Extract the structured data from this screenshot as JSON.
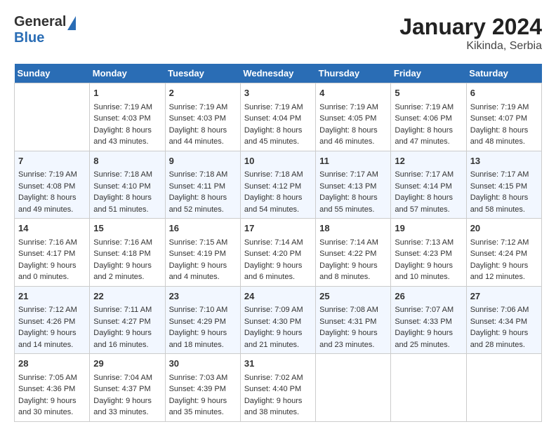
{
  "header": {
    "logo_general": "General",
    "logo_blue": "Blue",
    "month_year": "January 2024",
    "location": "Kikinda, Serbia"
  },
  "days_of_week": [
    "Sunday",
    "Monday",
    "Tuesday",
    "Wednesday",
    "Thursday",
    "Friday",
    "Saturday"
  ],
  "weeks": [
    [
      {
        "day": "",
        "sunrise": "",
        "sunset": "",
        "daylight": ""
      },
      {
        "day": "1",
        "sunrise": "Sunrise: 7:19 AM",
        "sunset": "Sunset: 4:03 PM",
        "daylight": "Daylight: 8 hours and 43 minutes."
      },
      {
        "day": "2",
        "sunrise": "Sunrise: 7:19 AM",
        "sunset": "Sunset: 4:03 PM",
        "daylight": "Daylight: 8 hours and 44 minutes."
      },
      {
        "day": "3",
        "sunrise": "Sunrise: 7:19 AM",
        "sunset": "Sunset: 4:04 PM",
        "daylight": "Daylight: 8 hours and 45 minutes."
      },
      {
        "day": "4",
        "sunrise": "Sunrise: 7:19 AM",
        "sunset": "Sunset: 4:05 PM",
        "daylight": "Daylight: 8 hours and 46 minutes."
      },
      {
        "day": "5",
        "sunrise": "Sunrise: 7:19 AM",
        "sunset": "Sunset: 4:06 PM",
        "daylight": "Daylight: 8 hours and 47 minutes."
      },
      {
        "day": "6",
        "sunrise": "Sunrise: 7:19 AM",
        "sunset": "Sunset: 4:07 PM",
        "daylight": "Daylight: 8 hours and 48 minutes."
      }
    ],
    [
      {
        "day": "7",
        "sunrise": "Sunrise: 7:19 AM",
        "sunset": "Sunset: 4:08 PM",
        "daylight": "Daylight: 8 hours and 49 minutes."
      },
      {
        "day": "8",
        "sunrise": "Sunrise: 7:18 AM",
        "sunset": "Sunset: 4:10 PM",
        "daylight": "Daylight: 8 hours and 51 minutes."
      },
      {
        "day": "9",
        "sunrise": "Sunrise: 7:18 AM",
        "sunset": "Sunset: 4:11 PM",
        "daylight": "Daylight: 8 hours and 52 minutes."
      },
      {
        "day": "10",
        "sunrise": "Sunrise: 7:18 AM",
        "sunset": "Sunset: 4:12 PM",
        "daylight": "Daylight: 8 hours and 54 minutes."
      },
      {
        "day": "11",
        "sunrise": "Sunrise: 7:17 AM",
        "sunset": "Sunset: 4:13 PM",
        "daylight": "Daylight: 8 hours and 55 minutes."
      },
      {
        "day": "12",
        "sunrise": "Sunrise: 7:17 AM",
        "sunset": "Sunset: 4:14 PM",
        "daylight": "Daylight: 8 hours and 57 minutes."
      },
      {
        "day": "13",
        "sunrise": "Sunrise: 7:17 AM",
        "sunset": "Sunset: 4:15 PM",
        "daylight": "Daylight: 8 hours and 58 minutes."
      }
    ],
    [
      {
        "day": "14",
        "sunrise": "Sunrise: 7:16 AM",
        "sunset": "Sunset: 4:17 PM",
        "daylight": "Daylight: 9 hours and 0 minutes."
      },
      {
        "day": "15",
        "sunrise": "Sunrise: 7:16 AM",
        "sunset": "Sunset: 4:18 PM",
        "daylight": "Daylight: 9 hours and 2 minutes."
      },
      {
        "day": "16",
        "sunrise": "Sunrise: 7:15 AM",
        "sunset": "Sunset: 4:19 PM",
        "daylight": "Daylight: 9 hours and 4 minutes."
      },
      {
        "day": "17",
        "sunrise": "Sunrise: 7:14 AM",
        "sunset": "Sunset: 4:20 PM",
        "daylight": "Daylight: 9 hours and 6 minutes."
      },
      {
        "day": "18",
        "sunrise": "Sunrise: 7:14 AM",
        "sunset": "Sunset: 4:22 PM",
        "daylight": "Daylight: 9 hours and 8 minutes."
      },
      {
        "day": "19",
        "sunrise": "Sunrise: 7:13 AM",
        "sunset": "Sunset: 4:23 PM",
        "daylight": "Daylight: 9 hours and 10 minutes."
      },
      {
        "day": "20",
        "sunrise": "Sunrise: 7:12 AM",
        "sunset": "Sunset: 4:24 PM",
        "daylight": "Daylight: 9 hours and 12 minutes."
      }
    ],
    [
      {
        "day": "21",
        "sunrise": "Sunrise: 7:12 AM",
        "sunset": "Sunset: 4:26 PM",
        "daylight": "Daylight: 9 hours and 14 minutes."
      },
      {
        "day": "22",
        "sunrise": "Sunrise: 7:11 AM",
        "sunset": "Sunset: 4:27 PM",
        "daylight": "Daylight: 9 hours and 16 minutes."
      },
      {
        "day": "23",
        "sunrise": "Sunrise: 7:10 AM",
        "sunset": "Sunset: 4:29 PM",
        "daylight": "Daylight: 9 hours and 18 minutes."
      },
      {
        "day": "24",
        "sunrise": "Sunrise: 7:09 AM",
        "sunset": "Sunset: 4:30 PM",
        "daylight": "Daylight: 9 hours and 21 minutes."
      },
      {
        "day": "25",
        "sunrise": "Sunrise: 7:08 AM",
        "sunset": "Sunset: 4:31 PM",
        "daylight": "Daylight: 9 hours and 23 minutes."
      },
      {
        "day": "26",
        "sunrise": "Sunrise: 7:07 AM",
        "sunset": "Sunset: 4:33 PM",
        "daylight": "Daylight: 9 hours and 25 minutes."
      },
      {
        "day": "27",
        "sunrise": "Sunrise: 7:06 AM",
        "sunset": "Sunset: 4:34 PM",
        "daylight": "Daylight: 9 hours and 28 minutes."
      }
    ],
    [
      {
        "day": "28",
        "sunrise": "Sunrise: 7:05 AM",
        "sunset": "Sunset: 4:36 PM",
        "daylight": "Daylight: 9 hours and 30 minutes."
      },
      {
        "day": "29",
        "sunrise": "Sunrise: 7:04 AM",
        "sunset": "Sunset: 4:37 PM",
        "daylight": "Daylight: 9 hours and 33 minutes."
      },
      {
        "day": "30",
        "sunrise": "Sunrise: 7:03 AM",
        "sunset": "Sunset: 4:39 PM",
        "daylight": "Daylight: 9 hours and 35 minutes."
      },
      {
        "day": "31",
        "sunrise": "Sunrise: 7:02 AM",
        "sunset": "Sunset: 4:40 PM",
        "daylight": "Daylight: 9 hours and 38 minutes."
      },
      {
        "day": "",
        "sunrise": "",
        "sunset": "",
        "daylight": ""
      },
      {
        "day": "",
        "sunrise": "",
        "sunset": "",
        "daylight": ""
      },
      {
        "day": "",
        "sunrise": "",
        "sunset": "",
        "daylight": ""
      }
    ]
  ]
}
